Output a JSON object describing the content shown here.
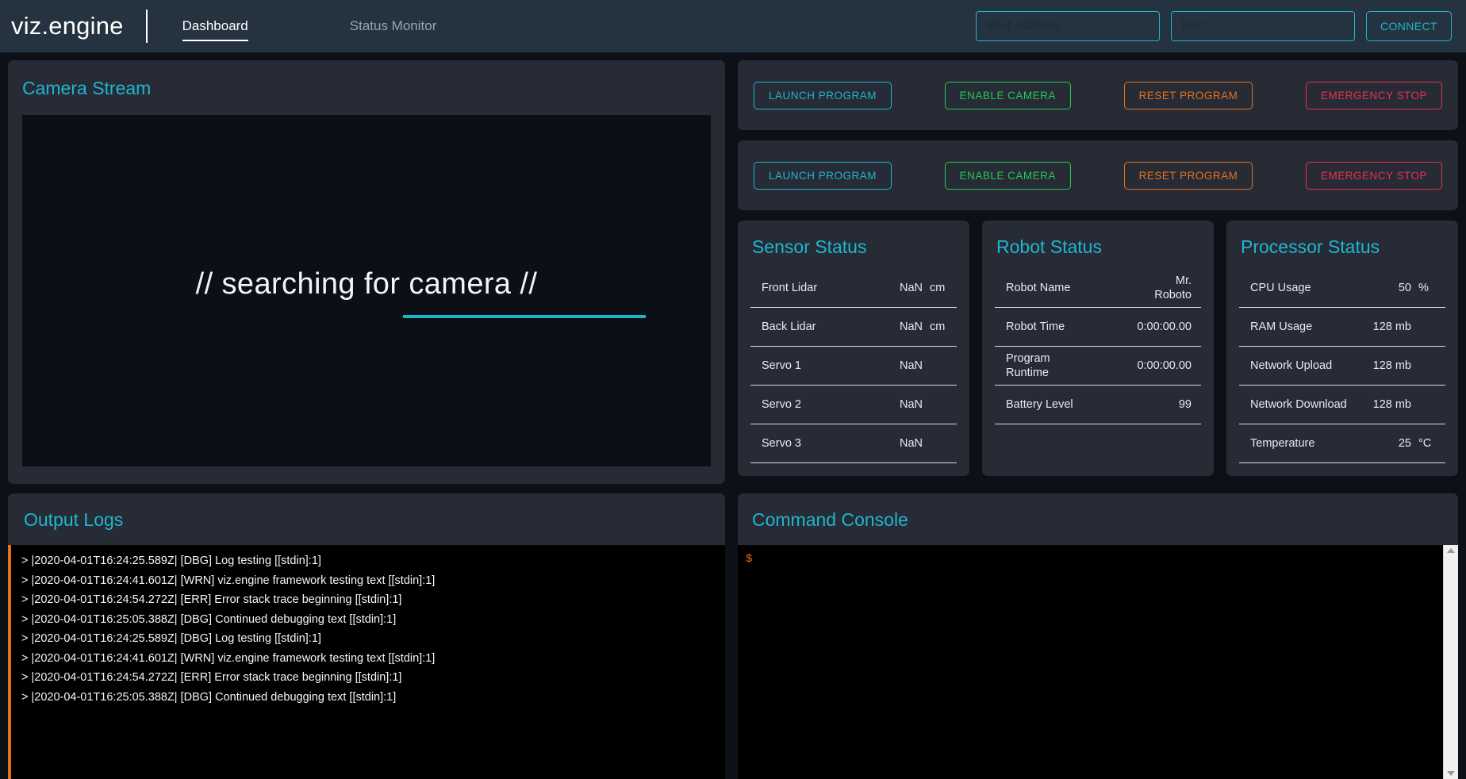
{
  "header": {
    "brand": "viz.engine",
    "tabs": [
      {
        "label": "Dashboard",
        "active": true
      },
      {
        "label": "Status Monitor",
        "active": false
      }
    ],
    "ip_placeholder": "IPv4 Address",
    "ip_value": "",
    "port_placeholder": "Port",
    "port_value": "",
    "connect_label": "CONNECT"
  },
  "camera": {
    "title": "Camera Stream",
    "status_text": "// searching for camera //"
  },
  "controls": {
    "rows": [
      {
        "buttons": [
          {
            "label": "LAUNCH PROGRAM",
            "color": "#1fb6cf"
          },
          {
            "label": "ENABLE CAMERA",
            "color": "#28c653"
          },
          {
            "label": "RESET PROGRAM",
            "color": "#e8711c"
          },
          {
            "label": "EMERGENCY STOP",
            "color": "#e8304f"
          }
        ]
      },
      {
        "buttons": [
          {
            "label": "LAUNCH PROGRAM",
            "color": "#1fb6cf"
          },
          {
            "label": "ENABLE CAMERA",
            "color": "#28c653"
          },
          {
            "label": "RESET PROGRAM",
            "color": "#e8711c"
          },
          {
            "label": "EMERGENCY STOP",
            "color": "#e8304f"
          }
        ]
      }
    ]
  },
  "sensor_status": {
    "title": "Sensor Status",
    "rows": [
      {
        "label": "Front Lidar",
        "value": "NaN",
        "unit": "cm"
      },
      {
        "label": "Back Lidar",
        "value": "NaN",
        "unit": "cm"
      },
      {
        "label": "Servo 1",
        "value": "NaN",
        "unit": ""
      },
      {
        "label": "Servo 2",
        "value": "NaN",
        "unit": ""
      },
      {
        "label": "Servo 3",
        "value": "NaN",
        "unit": ""
      }
    ]
  },
  "robot_status": {
    "title": "Robot Status",
    "rows": [
      {
        "label": "Robot Name",
        "value": "Mr. Roboto",
        "unit": ""
      },
      {
        "label": "Robot Time",
        "value": "0:00:00.00",
        "unit": ""
      },
      {
        "label": "Program Runtime",
        "value": "0:00:00.00",
        "unit": ""
      },
      {
        "label": "Battery Level",
        "value": "99",
        "unit": ""
      }
    ]
  },
  "processor_status": {
    "title": "Processor Status",
    "rows": [
      {
        "label": "CPU Usage",
        "value": "50",
        "unit": "%"
      },
      {
        "label": "RAM Usage",
        "value": "128 mb",
        "unit": ""
      },
      {
        "label": "Network Upload",
        "value": "128 mb",
        "unit": ""
      },
      {
        "label": "Network Download",
        "value": "128 mb",
        "unit": ""
      },
      {
        "label": "Temperature",
        "value": "25",
        "unit": "°C"
      }
    ]
  },
  "logs": {
    "title": "Output Logs",
    "lines": [
      "> |2020-04-01T16:24:25.589Z| [DBG] Log testing [[stdin]:1]",
      "> |2020-04-01T16:24:41.601Z| [WRN] viz.engine framework testing text [[stdin]:1]",
      "> |2020-04-01T16:24:54.272Z| [ERR] Error stack trace beginning [[stdin]:1]",
      "> |2020-04-01T16:25:05.388Z| [DBG] Continued debugging text [[stdin]:1]",
      "> |2020-04-01T16:24:25.589Z| [DBG] Log testing [[stdin]:1]",
      "> |2020-04-01T16:24:41.601Z| [WRN] viz.engine framework testing text [[stdin]:1]",
      "> |2020-04-01T16:24:54.272Z| [ERR] Error stack trace beginning [[stdin]:1]",
      "> |2020-04-01T16:25:05.388Z| [DBG] Continued debugging text [[stdin]:1]"
    ]
  },
  "console": {
    "title": "Command Console",
    "prompt": "$",
    "input_value": ""
  }
}
